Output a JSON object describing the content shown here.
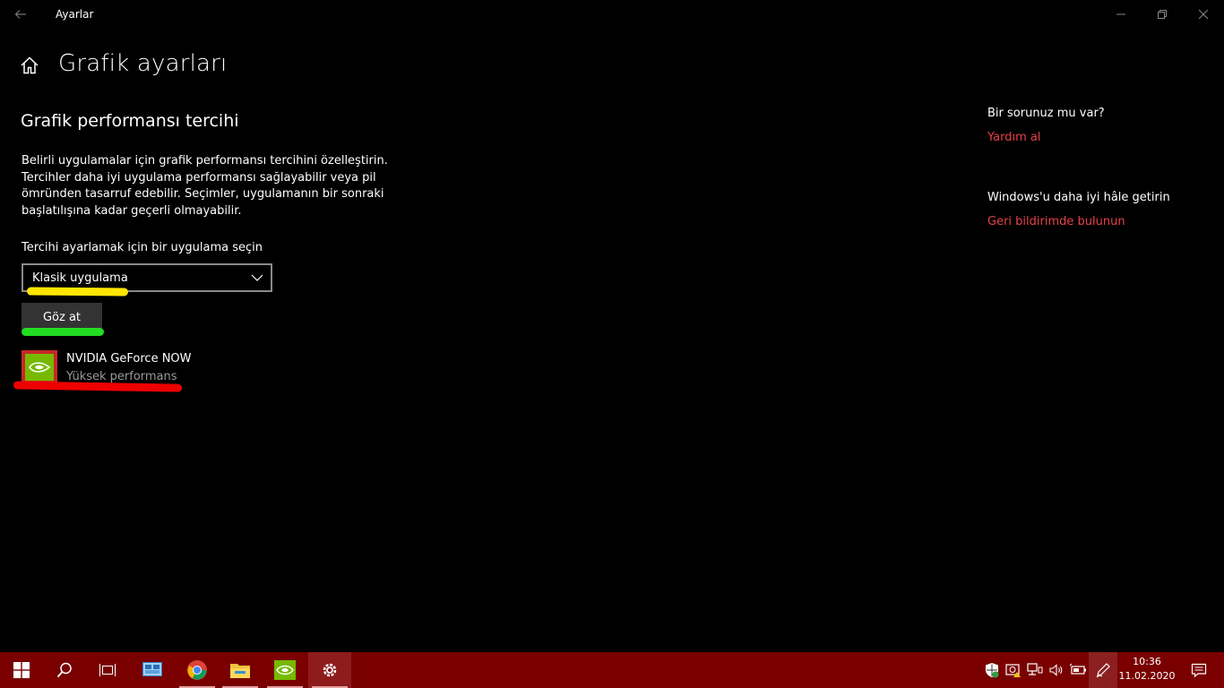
{
  "window": {
    "app_title": "Ayarlar",
    "page_title": "Grafik ayarları"
  },
  "main": {
    "section_title": "Grafik performansı tercihi",
    "description": "Belirli uygulamalar için grafik performansı tercihini özelleştirin. Tercihler daha iyi uygulama performansı sağlayabilir veya pil ömründen tasarruf edebilir. Seçimler, uygulamanın bir sonraki başlatılışına kadar geçerli olmayabilir.",
    "select_label": "Tercihi ayarlamak için bir uygulama seçin",
    "dropdown_value": "Klasik uygulama",
    "browse_label": "Göz at",
    "apps": [
      {
        "name": "NVIDIA GeForce NOW",
        "preference": "Yüksek performans"
      }
    ]
  },
  "side": {
    "help_question": "Bir sorunuz mu var?",
    "help_link": "Yardım al",
    "improve_question": "Windows'u daha iyi hâle getirin",
    "improve_link": "Geri bildirimde bulunun"
  },
  "taskbar": {
    "time": "10:36",
    "date": "11.02.2020"
  },
  "colors": {
    "link": "#e8414a",
    "taskbar": "#7a0000",
    "nvidia_green": "#76b900"
  }
}
